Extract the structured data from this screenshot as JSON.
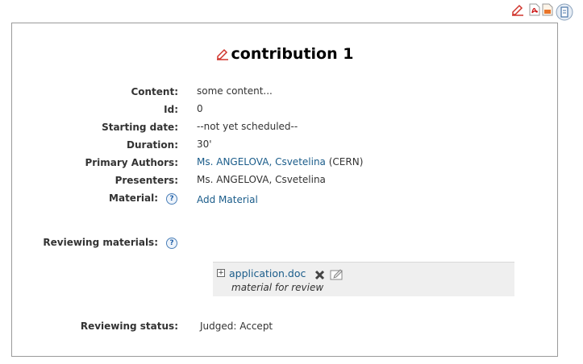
{
  "top_toolbar": {
    "icons": [
      "edit-icon",
      "pdf-icon",
      "export-icon",
      "print-icon"
    ]
  },
  "contribution": {
    "title": "contribution 1",
    "fields": {
      "content_label": "Content:",
      "content_value": "some content...",
      "id_label": "Id:",
      "id_value": "0",
      "starting_date_label": "Starting date:",
      "starting_date_value": "--not yet scheduled--",
      "duration_label": "Duration:",
      "duration_value": "30'",
      "primary_authors_label": "Primary Authors:",
      "primary_authors_link": "Ms. ANGELOVA, Csvetelina",
      "primary_authors_affiliation": "(CERN)",
      "presenters_label": "Presenters:",
      "presenters_value": "Ms. ANGELOVA, Csvetelina",
      "material_label": "Material:",
      "add_material": "Add Material"
    },
    "reviewing": {
      "materials_label": "Reviewing materials:",
      "file_name": "application.doc",
      "file_description": "material for review",
      "status_label": "Reviewing status:",
      "status_value": "Judged: Accept"
    },
    "help_glyph": "?"
  },
  "colors": {
    "link": "#1a5c8a",
    "border": "#9a9a9a",
    "review_box": "#efefef",
    "edit_icon": "#d0342c"
  }
}
